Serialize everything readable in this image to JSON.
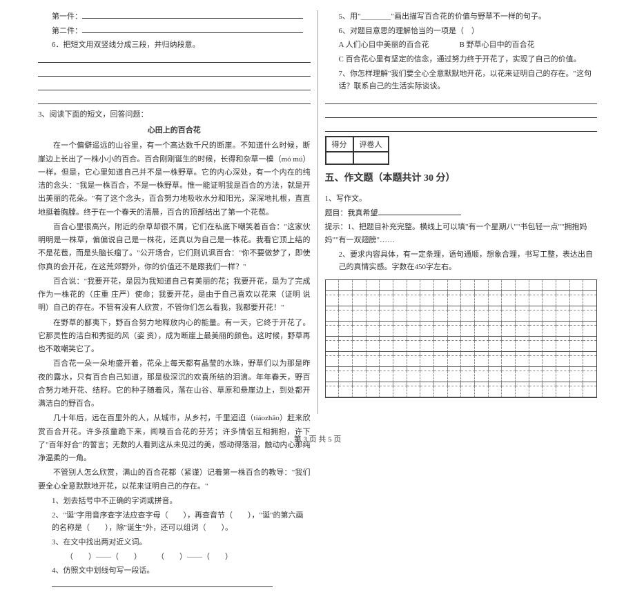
{
  "left": {
    "item_first": "第一件：",
    "item_second": "第二件：",
    "q6": "6．把短文用双竖线分成三段，并归纳段意。",
    "q3_title": "3、阅读下面的短文，回答问题：",
    "essay_title": "心田上的百合花",
    "p1": "在一个偏僻遥远的山谷里，有一个高达数千尺的断崖。不知道什么时候，断崖边上长出了一株小小的百合。百合刚刚诞生的时候，长得和杂草一模（mó  mú）一样。但是，它心里知道自己并不是一株野草。它的内心深处，有一个内在的纯洁的念头：\"我是一株百合，不是一株野草。惟一能证明我是百合的方法，就是开出美丽的花朵。\"有了这个念头，百合努力地吸收水分和阳光，深深地扎根，直直地挺着胸膛。终于在一个春天的清晨，百合的顶部结出了第一个花苞。",
    "p2": "百合心里很高兴，附近的杂草却很不屑，它们在私底下嘲笑着百合：\"这家伙明明是一株草，偏偏说自己是一株花，还真以为自己是一株花。我看它顶上结的不是花苞，而是头脑长瘤了。\"公开场合，它们则讥讽百合：\"你不要做梦了，即使你真的会开花，在这荒郊野外，你的价值还不是跟我们一样？\"",
    "p3": "百合说：\"我要开花，是因为我知道自己有美丽的花；我要开花，是为了完成作为一株花的（庄重  庄严）使命；我要开花，是由于自己喜欢以花来（证明  说明）自己的存在。不管有没有人欣赏，不管你们怎么看我，我都要开花！\"",
    "p4": "在野草的鄙夷下，野百合努力地释放内心的能量。有一天，它终于开花了。它那灵性的洁白和秀挺的风（姿  资），成为断崖上最美丽的颜色。这时候，野草再也不敢嘲笑它了。",
    "p5": "百合花一朵一朵地盛开着，花朵上每天都有晶莹的水珠，野草们以为那是昨夜的露水，只有百合自己知道，那是极深沉的欢喜所结的泪滴。年年春天，野百合努力地开花、结籽。它的种子随着风，落在山谷、草原和悬崖边上，到处都开满洁白的野百合。",
    "p6": "几十年后，远在百里外的人，从城市，从乡村，千里迢迢（tiáozhāo）赶来欣赏百合开花。许多孩童跪下来，闻嗅百合花的芬芳；许多情侣互相拥抱，许下了\"百年好合\"的誓言；无数的人看到这从未见过的美，感动得落泪，触动内心那纯净温柔的一角。",
    "p7": "不管别人怎么欣赏，满山的百合花都（紧谨）记着第一株百合的教导：\"我们要全心全意默默地开花，以花来证明自己的存在。\"",
    "sq1": "1、划去括号中不正确的字词或拼音。",
    "sq2": "2、\"诞\"字用音序查字法应查字母（　　），再查音节（　　），\"诞\"的第六画的名称是（　　），除\"诞生\"外，还可以组词（　　）。",
    "sq3": "3、在文中找出两对近义词。",
    "sq3_line": "（　　）——（　　）　　　（　　）——（　　）",
    "sq4": "4、仿照文中划线句写一段话。"
  },
  "right": {
    "sq5": "5、用\"＿＿＿＿\"画出描写百合花的价值与野草不一样的句子。",
    "sq6": "6、对题目意思的理解恰当的一项是（　）",
    "opt_a": "A  人们心目中美丽的百合花　　　　B  野草心目中的百合花",
    "opt_c": "C  百合花心里有坚定的信念，通过努力终于开花了，实现了自己的价值。",
    "sq7": "7、你怎样理解\"我们要全心全意默默地开花，以花来证明自己的存在。\"这句话？联系自己的生活实际谈谈。",
    "scorebox": {
      "score_label": "得分",
      "reviewer_label": "评卷人"
    },
    "section5_title": "五、作文题（本题共计 30 分）",
    "w1": "1、写作文。",
    "w_topic": "题目：我真希望",
    "w_hint": "提示：1、把题目补充完整。横线上可以填\"有一个星期八\"\"书包轻一点\"\"拥抱妈妈\"\"有一双翅膀\"……",
    "w_req": "2、要求内容具体，有一定条理，语句通顺，想象合理，书写工整，表达出自己的真情实感。字数在450字左右。"
  },
  "footer": "第 3 页  共 5 页"
}
